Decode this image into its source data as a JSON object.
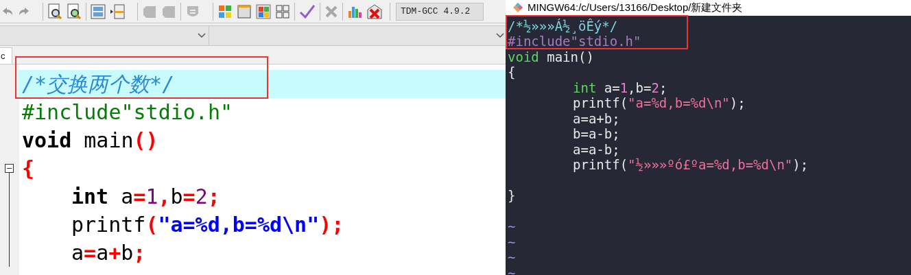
{
  "ide": {
    "compiler_select": {
      "value": "TDM-GCC 4.9.2"
    },
    "file_tab": {
      "label": "c"
    },
    "editor_lines": [
      {
        "highlighted": true,
        "indented": false,
        "fold": false,
        "tokens": [
          {
            "kind": "comment",
            "text": "/*交换两个数*/"
          }
        ]
      },
      {
        "highlighted": false,
        "indented": false,
        "fold": false,
        "tokens": [
          {
            "kind": "preprocessor",
            "text": "#include\"stdio.h\""
          }
        ]
      },
      {
        "highlighted": false,
        "indented": false,
        "fold": false,
        "tokens": [
          {
            "kind": "keyword",
            "text": "void"
          },
          {
            "kind": "plain",
            "text": " main"
          },
          {
            "kind": "operator",
            "text": "()"
          }
        ]
      },
      {
        "highlighted": false,
        "indented": false,
        "fold": true,
        "tokens": [
          {
            "kind": "operator",
            "text": "{"
          }
        ]
      },
      {
        "highlighted": false,
        "indented": true,
        "fold": false,
        "tokens": [
          {
            "kind": "keyword",
            "text": "int"
          },
          {
            "kind": "plain",
            "text": " a"
          },
          {
            "kind": "operator",
            "text": "="
          },
          {
            "kind": "number",
            "text": "1"
          },
          {
            "kind": "operator",
            "text": ","
          },
          {
            "kind": "plain",
            "text": "b"
          },
          {
            "kind": "operator",
            "text": "="
          },
          {
            "kind": "number",
            "text": "2"
          },
          {
            "kind": "operator",
            "text": ";"
          }
        ]
      },
      {
        "highlighted": false,
        "indented": true,
        "fold": false,
        "tokens": [
          {
            "kind": "plain",
            "text": "printf"
          },
          {
            "kind": "operator",
            "text": "("
          },
          {
            "kind": "string",
            "text": "\"a=%d,b=%d\\n\""
          },
          {
            "kind": "operator",
            "text": ");"
          }
        ]
      },
      {
        "highlighted": false,
        "indented": true,
        "fold": false,
        "tokens": [
          {
            "kind": "plain",
            "text": "a"
          },
          {
            "kind": "operator",
            "text": "="
          },
          {
            "kind": "plain",
            "text": "a"
          },
          {
            "kind": "operator",
            "text": "+"
          },
          {
            "kind": "plain",
            "text": "b"
          },
          {
            "kind": "operator",
            "text": ";"
          }
        ]
      }
    ]
  },
  "terminal": {
    "window": {
      "title": "MINGW64:/c/Users/13166/Desktop/新建文件夹"
    },
    "lines": [
      {
        "kind": "code",
        "indented": false,
        "tokens": [
          {
            "kind": "comment",
            "text": "/*½»»»Á½¸öÊý*/"
          }
        ]
      },
      {
        "kind": "code",
        "indented": false,
        "tokens": [
          {
            "kind": "preprocessor",
            "text": "#include\"stdio.h\""
          }
        ]
      },
      {
        "kind": "code",
        "indented": false,
        "tokens": [
          {
            "kind": "keyword",
            "text": "void"
          },
          {
            "kind": "plain",
            "text": " main()"
          }
        ]
      },
      {
        "kind": "code",
        "indented": false,
        "tokens": [
          {
            "kind": "plain",
            "text": "{"
          }
        ]
      },
      {
        "kind": "code",
        "indented": true,
        "tokens": [
          {
            "kind": "keyword",
            "text": "int"
          },
          {
            "kind": "plain",
            "text": " a="
          },
          {
            "kind": "number",
            "text": "1"
          },
          {
            "kind": "plain",
            "text": ",b="
          },
          {
            "kind": "number",
            "text": "2"
          },
          {
            "kind": "plain",
            "text": ";"
          }
        ]
      },
      {
        "kind": "code",
        "indented": true,
        "tokens": [
          {
            "kind": "plain",
            "text": "printf("
          },
          {
            "kind": "string",
            "text": "\"a=%d,b=%d\\n\""
          },
          {
            "kind": "plain",
            "text": ");"
          }
        ]
      },
      {
        "kind": "code",
        "indented": true,
        "tokens": [
          {
            "kind": "plain",
            "text": "a=a+b;"
          }
        ]
      },
      {
        "kind": "code",
        "indented": true,
        "tokens": [
          {
            "kind": "plain",
            "text": "b=a-b;"
          }
        ]
      },
      {
        "kind": "code",
        "indented": true,
        "tokens": [
          {
            "kind": "plain",
            "text": "a=a-b;"
          }
        ]
      },
      {
        "kind": "code",
        "indented": true,
        "tokens": [
          {
            "kind": "plain",
            "text": "printf("
          },
          {
            "kind": "string",
            "text": "\"½»»»ºó£ºa=%d,b=%d\\n\""
          },
          {
            "kind": "plain",
            "text": ");"
          }
        ]
      },
      {
        "kind": "blank"
      },
      {
        "kind": "code",
        "indented": false,
        "tokens": [
          {
            "kind": "plain",
            "text": "}"
          }
        ]
      },
      {
        "kind": "blank"
      },
      {
        "kind": "tilde",
        "indented": false,
        "tokens": [
          {
            "kind": "tilde",
            "text": "~"
          }
        ]
      },
      {
        "kind": "tilde",
        "indented": false,
        "tokens": [
          {
            "kind": "tilde",
            "text": "~"
          }
        ]
      },
      {
        "kind": "tilde",
        "indented": false,
        "tokens": [
          {
            "kind": "tilde",
            "text": "~"
          }
        ]
      },
      {
        "kind": "tilde",
        "indented": false,
        "tokens": [
          {
            "kind": "tilde",
            "text": "~"
          }
        ]
      }
    ]
  }
}
